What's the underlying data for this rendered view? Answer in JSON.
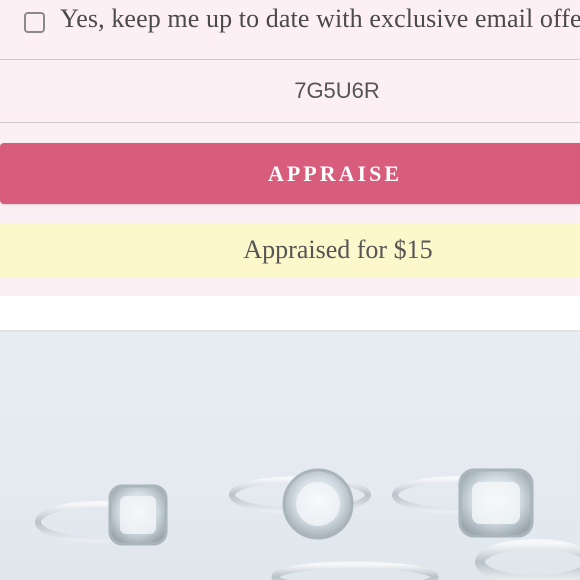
{
  "consent": {
    "checked": false,
    "label": "Yes, keep me up to date with exclusive email offers"
  },
  "code_input": {
    "value": "7G5U6R"
  },
  "appraise_button": {
    "label": "APPRAISE"
  },
  "result": {
    "text": "Appraised for $15"
  },
  "product_image": {
    "subject": "silver halo engagement rings"
  },
  "colors": {
    "panel_background": "#fdf0f4",
    "button": "#d85d7d",
    "result_background": "#fdf7cc"
  }
}
